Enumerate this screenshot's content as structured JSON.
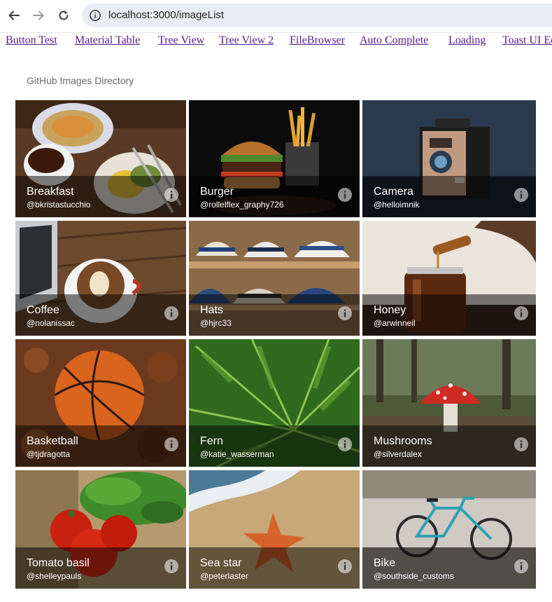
{
  "browser": {
    "back_icon": "arrow-left-icon",
    "forward_icon": "arrow-right-icon",
    "reload_icon": "reload-icon",
    "site_info_icon": "info-circle-icon",
    "url": "localhost:3000/imageList"
  },
  "nav_links": [
    {
      "label": "Button Test"
    },
    {
      "label": "Material Table"
    },
    {
      "label": "Tree View"
    },
    {
      "label": "Tree View 2"
    },
    {
      "label": "FileBrowser"
    },
    {
      "label": "Auto Complete"
    },
    {
      "label": "Loading"
    },
    {
      "label": "Toast UI Ed"
    }
  ],
  "page": {
    "heading": "GitHub Images Directory"
  },
  "images": [
    {
      "title": "Breakfast",
      "author": "@bkristastucchio"
    },
    {
      "title": "Burger",
      "author": "@rollelflex_graphy726"
    },
    {
      "title": "Camera",
      "author": "@helloimnik"
    },
    {
      "title": "Coffee",
      "author": "@nolanissac"
    },
    {
      "title": "Hats",
      "author": "@hjrc33"
    },
    {
      "title": "Honey",
      "author": "@arwinneil"
    },
    {
      "title": "Basketball",
      "author": "@tjdragotta"
    },
    {
      "title": "Fern",
      "author": "@katie_wasserman"
    },
    {
      "title": "Mushrooms",
      "author": "@silverdalex"
    },
    {
      "title": "Tomato basil",
      "author": "@shelleypauls"
    },
    {
      "title": "Sea star",
      "author": "@peterlaster"
    },
    {
      "title": "Bike",
      "author": "@southside_customs"
    }
  ],
  "colors": {
    "link": "#551a8b",
    "urlbar": "#e9eef6",
    "caption_overlay": "rgba(0,0,0,0.5)"
  }
}
